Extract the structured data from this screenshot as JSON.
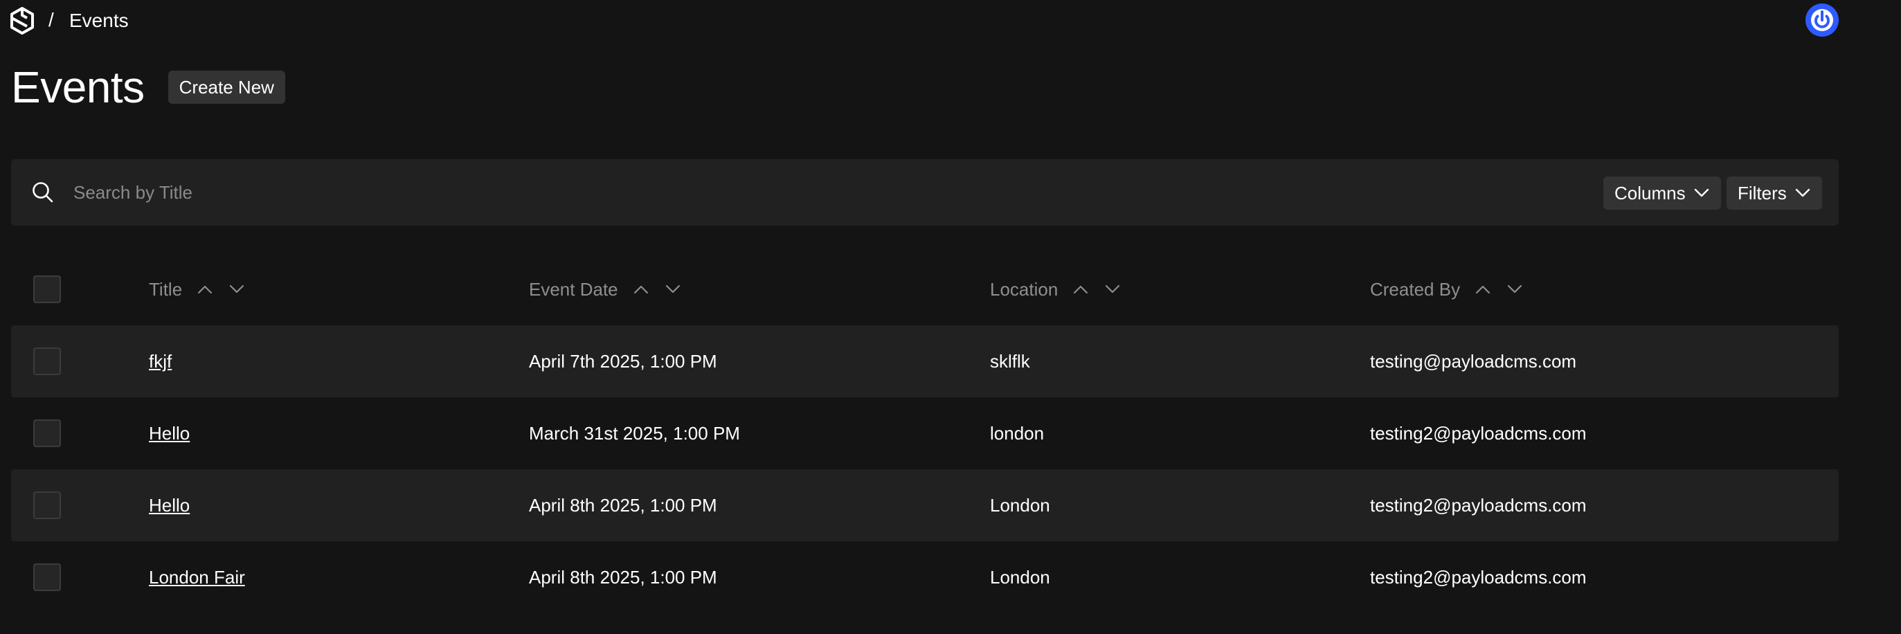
{
  "breadcrumb": {
    "separator": "/",
    "current": "Events"
  },
  "header": {
    "title": "Events",
    "create_label": "Create New"
  },
  "search": {
    "placeholder": "Search by Title",
    "value": ""
  },
  "toolbar": {
    "columns_label": "Columns",
    "filters_label": "Filters"
  },
  "table": {
    "headers": [
      "Title",
      "Event Date",
      "Location",
      "Created By"
    ],
    "rows": [
      {
        "title": "fkjf",
        "date": "April 7th 2025, 1:00 PM",
        "location": "sklflk",
        "created_by": "testing@payloadcms.com"
      },
      {
        "title": "Hello",
        "date": "March 31st 2025, 1:00 PM",
        "location": "london",
        "created_by": "testing2@payloadcms.com"
      },
      {
        "title": "Hello",
        "date": "April 8th 2025, 1:00 PM",
        "location": "London",
        "created_by": "testing2@payloadcms.com"
      },
      {
        "title": "London Fair",
        "date": "April 8th 2025, 1:00 PM",
        "location": "London",
        "created_by": "testing2@payloadcms.com"
      }
    ]
  },
  "icons": {
    "logo": "payload-logo-icon",
    "avatar": "power-icon",
    "search": "search-icon",
    "dropdown": "chevron-down-icon",
    "sort_asc": "chevron-up-icon",
    "sort_desc": "chevron-down-icon"
  },
  "colors": {
    "background": "#141414",
    "panel": "#212121",
    "button": "#333333",
    "avatar": "#2e5bff",
    "muted_text": "#8f8f8f"
  }
}
